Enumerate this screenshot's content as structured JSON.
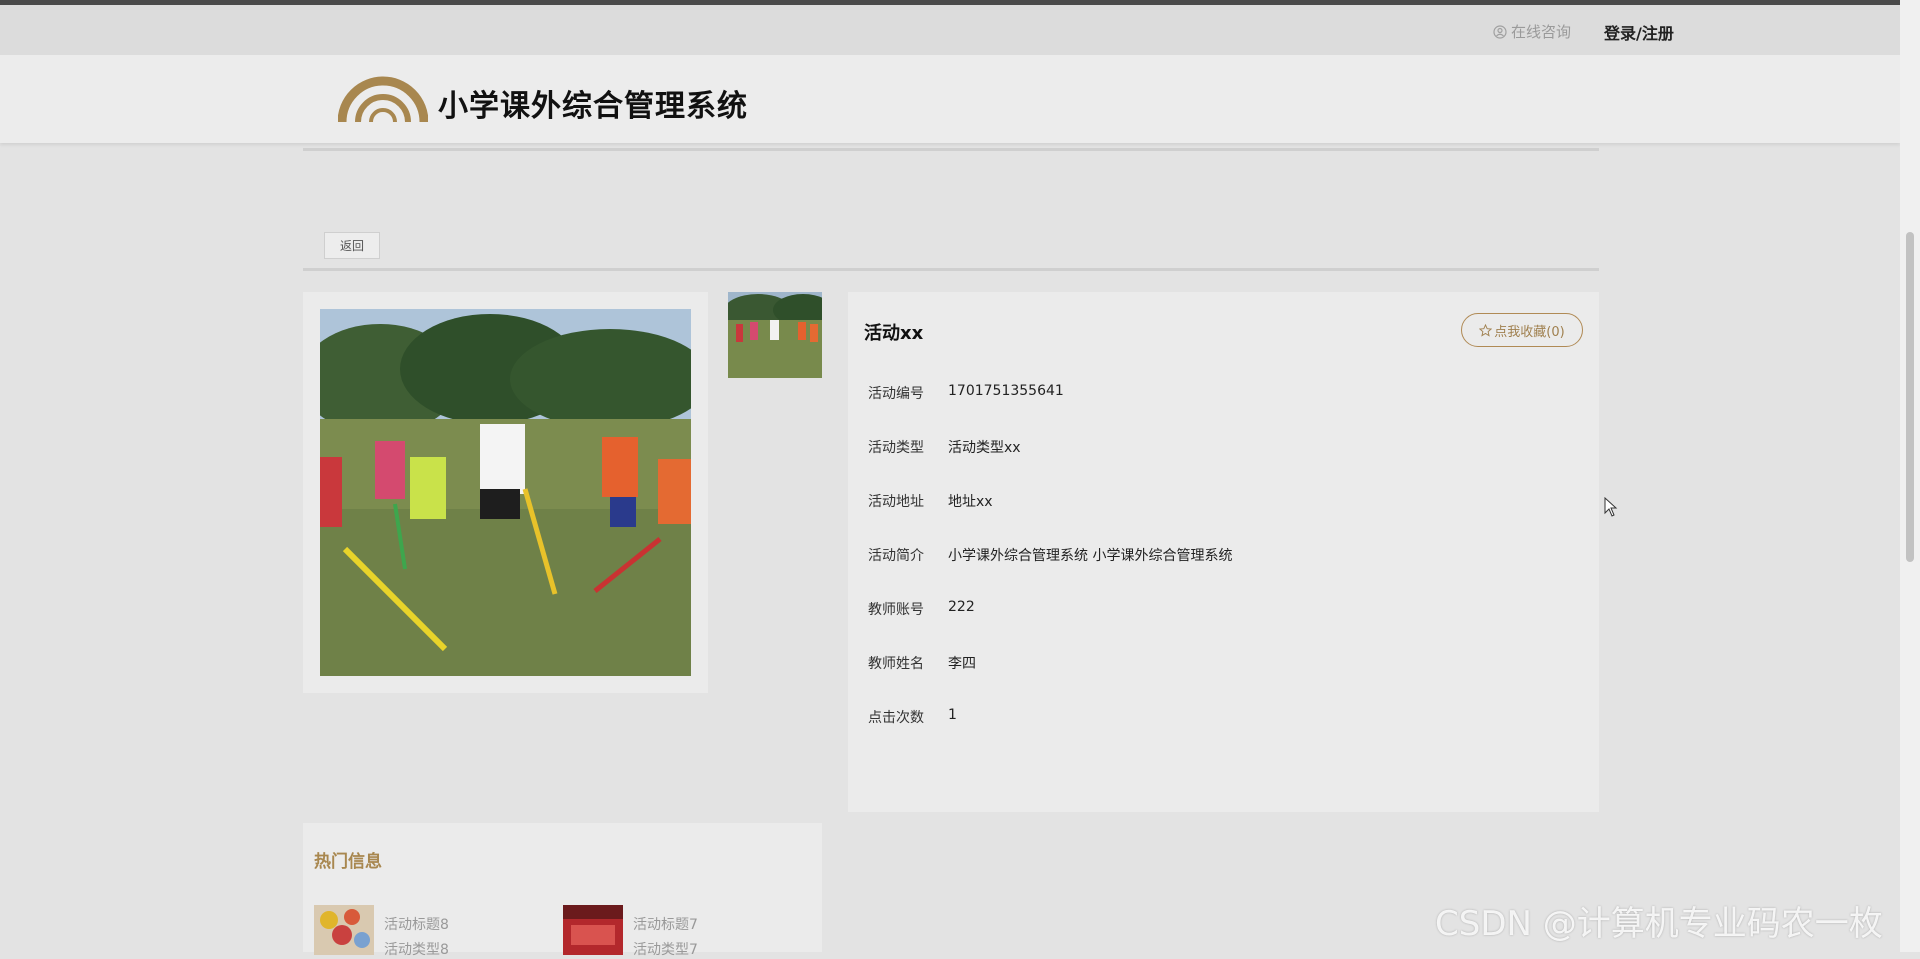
{
  "topbar": {
    "consult_label": "在线咨询",
    "login_label": "登录/注册"
  },
  "header": {
    "site_title": "小学课外综合管理系统"
  },
  "actions": {
    "back_label": "返回"
  },
  "detail": {
    "title": "活动xx",
    "favorite_label": "点我收藏(0)",
    "rows": [
      {
        "label": "活动编号",
        "value": "1701751355641"
      },
      {
        "label": "活动类型",
        "value": "活动类型xx"
      },
      {
        "label": "活动地址",
        "value": "地址xx"
      },
      {
        "label": "活动简介",
        "value": "小学课外综合管理系统 小学课外综合管理系统"
      },
      {
        "label": "教师账号",
        "value": "222"
      },
      {
        "label": "教师姓名",
        "value": "李四"
      },
      {
        "label": "点击次数",
        "value": "1"
      }
    ]
  },
  "hot": {
    "title": "热门信息",
    "items": [
      {
        "name": "活动标题8",
        "type": "活动类型8"
      },
      {
        "name": "活动标题7",
        "type": "活动类型7"
      }
    ]
  },
  "watermark": "CSDN @计算机专业码农一枚",
  "colors": {
    "accent": "#a8874f",
    "background": "#e3e3e3",
    "panel": "#ebebeb"
  }
}
